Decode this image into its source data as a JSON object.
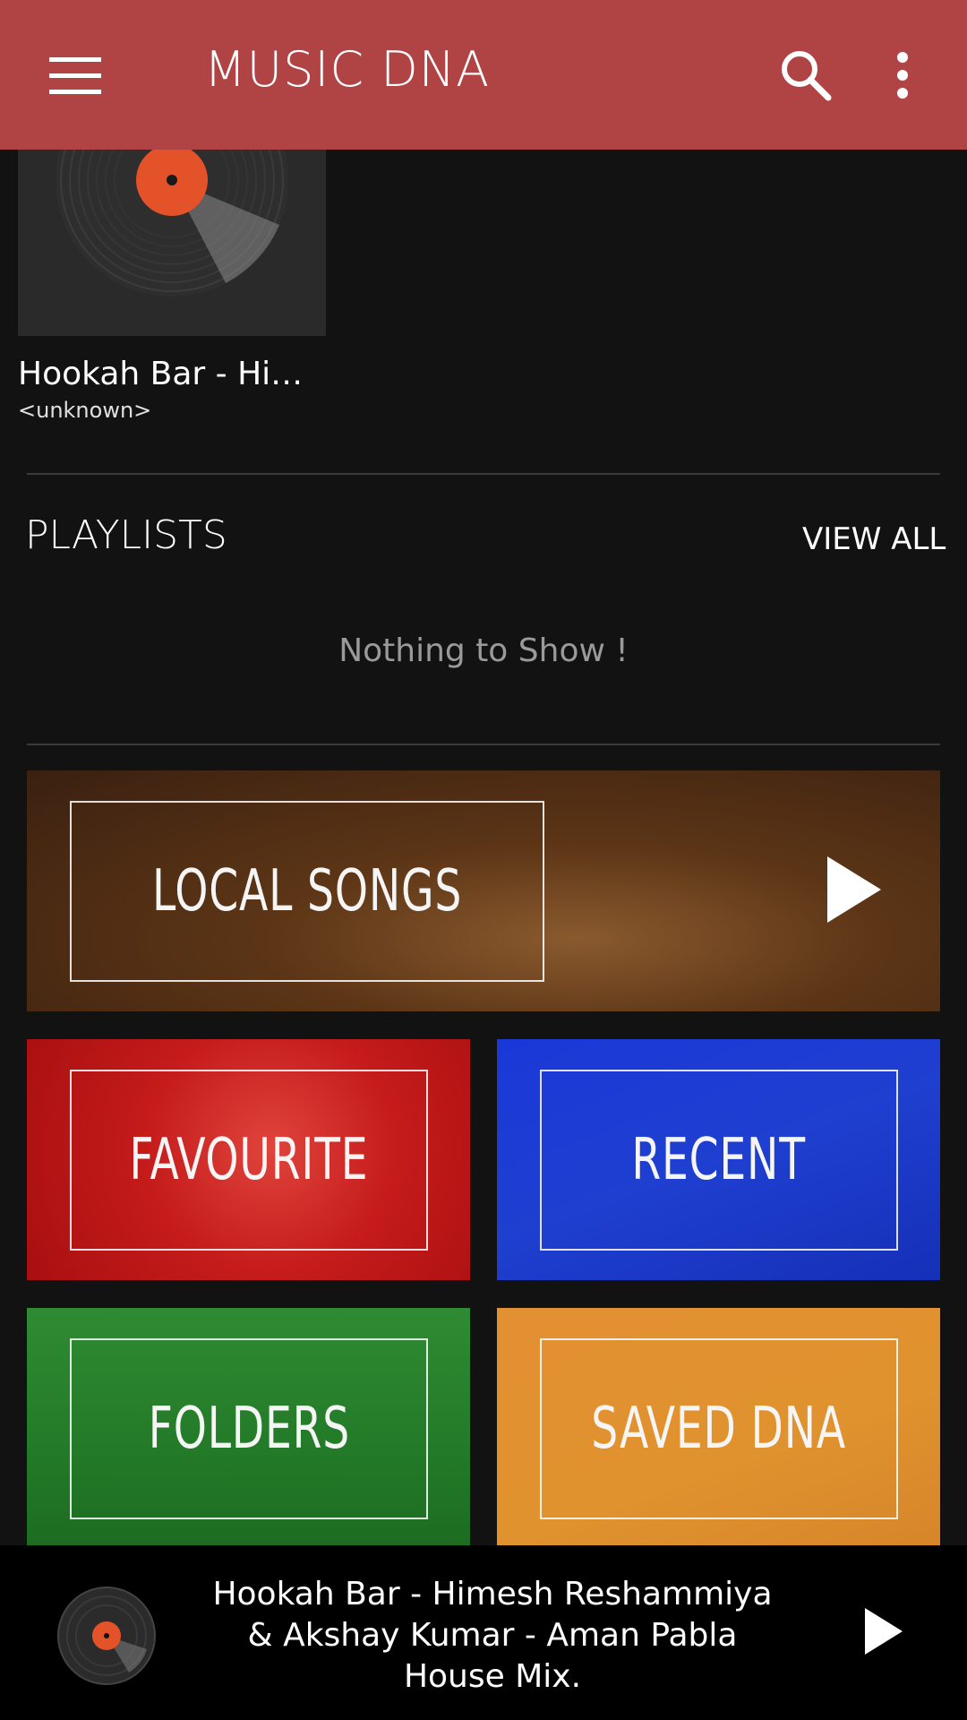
{
  "app_bar": {
    "title": "MUSIC DNA"
  },
  "recent_song": {
    "title": "Hookah Bar - Him…",
    "artist": "<unknown>"
  },
  "playlists": {
    "header": "PLAYLISTS",
    "view_all": "VIEW ALL",
    "empty_message": "Nothing to Show !"
  },
  "tiles": {
    "local_songs": "LOCAL SONGS",
    "favourite": "FAVOURITE",
    "recent": "RECENT",
    "folders": "FOLDERS",
    "saved_dna": "SAVED DNA"
  },
  "now_playing": {
    "title": "Hookah Bar - Himesh Reshammiya & Akshay Kumar - Aman Pabla House Mix."
  },
  "colors": {
    "app_bar": "#b04343",
    "background": "#121212",
    "vinyl_label": "#e4522a"
  },
  "icons": {
    "menu": "hamburger-menu-icon",
    "search": "search-icon",
    "more": "more-vert-icon",
    "play": "play-icon",
    "vinyl": "vinyl-record-icon"
  }
}
